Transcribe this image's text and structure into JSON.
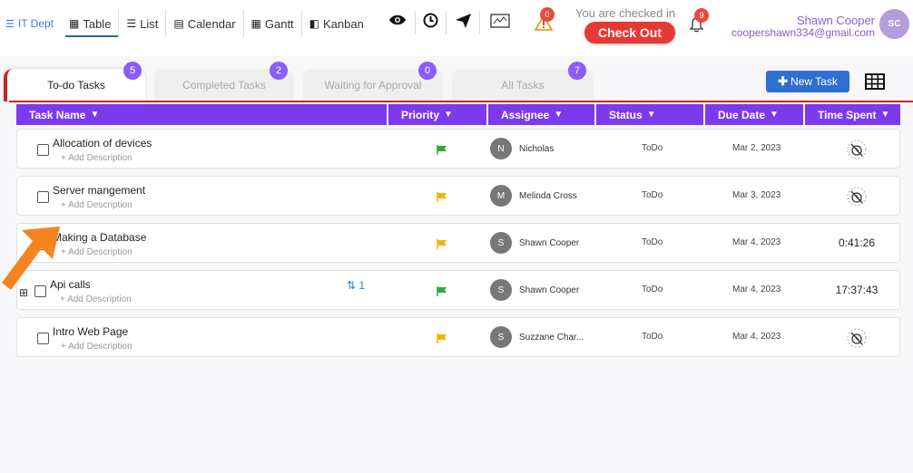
{
  "header": {
    "dept_label": "IT Dept",
    "views": [
      {
        "label": "Table",
        "icon": "table-icon",
        "active": true
      },
      {
        "label": "List",
        "icon": "list-icon"
      },
      {
        "label": "Calendar",
        "icon": "calendar-icon"
      },
      {
        "label": "Gantt",
        "icon": "gantt-icon"
      },
      {
        "label": "Kanban",
        "icon": "kanban-icon"
      }
    ],
    "alert_count": "0",
    "notification_count": "9",
    "checked_in_text": "You are checked in",
    "checkout_label": "Check Out",
    "user_name": "Shawn Cooper",
    "user_email": "coopershawn334@gmail.com",
    "user_initials": "SC"
  },
  "tabs": [
    {
      "label": "To-do Tasks",
      "count": "5",
      "active": true
    },
    {
      "label": "Completed Tasks",
      "count": "2"
    },
    {
      "label": "Waiting for Approval",
      "count": "0"
    },
    {
      "label": "All Tasks",
      "count": "7"
    }
  ],
  "new_task_label": "New Task",
  "columns": [
    "Task Name",
    "Priority",
    "Assignee",
    "Status",
    "Due Date",
    "Time Spent"
  ],
  "add_description_label": "+ Add Description",
  "colors": {
    "accent": "#7c3aed",
    "danger": "#e53935",
    "primary": "#2f6fd1",
    "flag_green": "#2eaa3a",
    "flag_yellow": "#f5b400"
  },
  "tasks": [
    {
      "name": "Allocation of devices",
      "priority_color": "#2eaa3a",
      "assignee_initial": "N",
      "assignee": "Nicholas",
      "status": "ToDo",
      "due": "Mar 2, 2023",
      "time": ""
    },
    {
      "name": "Server mangement",
      "priority_color": "#f5b400",
      "assignee_initial": "M",
      "assignee": "Melinda Cross",
      "status": "ToDo",
      "due": "Mar 3, 2023",
      "time": ""
    },
    {
      "name": "Making a Database",
      "priority_color": "#f5b400",
      "assignee_initial": "S",
      "assignee": "Shawn Cooper",
      "status": "ToDo",
      "due": "Mar 4, 2023",
      "time": "0:41:26"
    },
    {
      "name": "Api calls",
      "priority_color": "#2eaa3a",
      "assignee_initial": "S",
      "assignee": "Shawn Cooper",
      "status": "ToDo",
      "due": "Mar 4, 2023",
      "time": "17:37:43",
      "subtasks": "1"
    },
    {
      "name": "Intro Web Page",
      "priority_color": "#f5b400",
      "assignee_initial": "S",
      "assignee": "Suzzane Char...",
      "status": "ToDo",
      "due": "Mar 4, 2023",
      "time": ""
    }
  ]
}
